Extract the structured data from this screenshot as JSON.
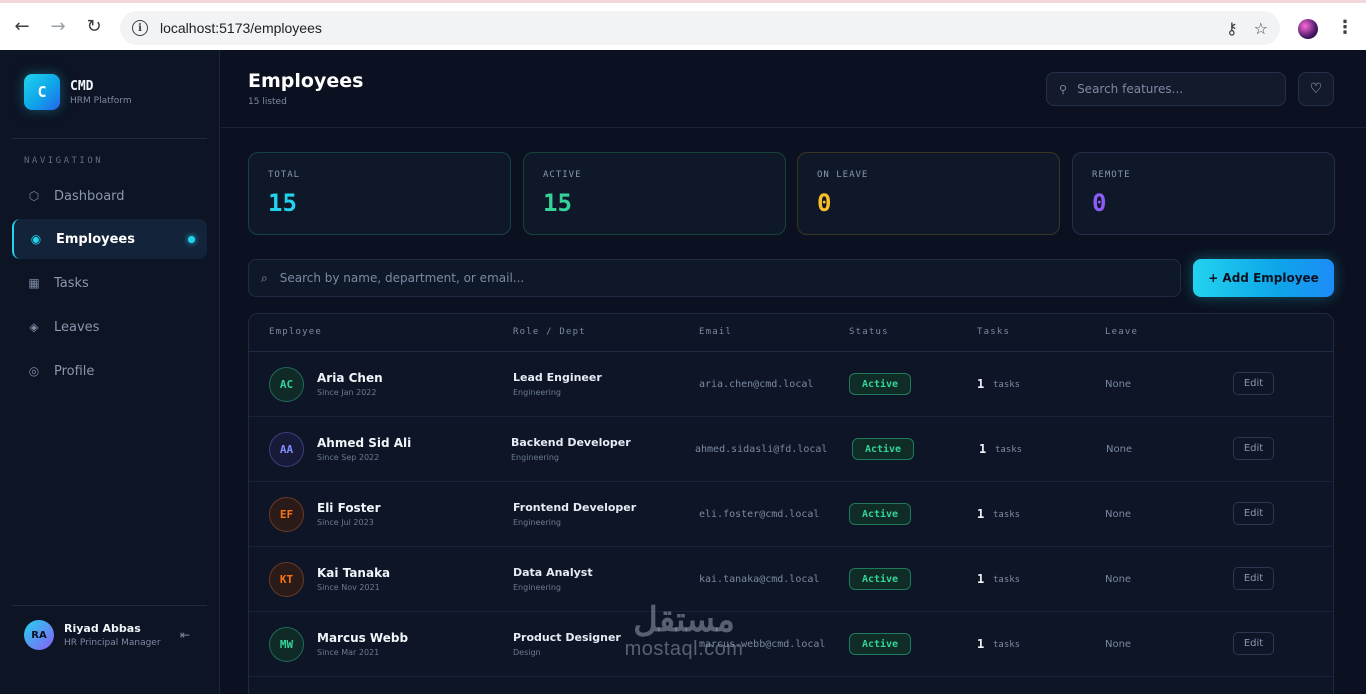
{
  "browser": {
    "url": "localhost:5173/employees",
    "icons": [
      "back-icon",
      "forward-icon",
      "reload-icon",
      "info-icon",
      "key-icon",
      "star-icon",
      "profile-avatar",
      "menu-dots-icon"
    ]
  },
  "sidebar": {
    "brand_initial": "C",
    "brand_name": "CMD",
    "brand_sub": "HRM Platform",
    "nav_label": "NAVIGATION",
    "items": [
      {
        "label": "Dashboard",
        "icon": "hexagon-icon"
      },
      {
        "label": "Employees",
        "icon": "radio-dot-icon",
        "active": true
      },
      {
        "label": "Tasks",
        "icon": "grid-icon"
      },
      {
        "label": "Leaves",
        "icon": "diamond-icon"
      },
      {
        "label": "Profile",
        "icon": "circle-icon"
      }
    ],
    "user": {
      "initials": "RA",
      "name": "Riyad Abbas",
      "role": "HR Principal Manager"
    }
  },
  "header": {
    "title": "Employees",
    "subtitle": "15 listed",
    "search_placeholder": "Search features..."
  },
  "stats": [
    {
      "label": "TOTAL",
      "value": "15",
      "color": "#22d3ee"
    },
    {
      "label": "ACTIVE",
      "value": "15",
      "color": "#34d399"
    },
    {
      "label": "ON LEAVE",
      "value": "0",
      "color": "#fbbf24"
    },
    {
      "label": "REMOTE",
      "value": "0",
      "color": "#8b5cf6"
    }
  ],
  "search": {
    "placeholder": "Search by name, department, or email..."
  },
  "add_button": "+ Add Employee",
  "table": {
    "columns": [
      "Employee",
      "Role / Dept",
      "Email",
      "Status",
      "Tasks",
      "Leave"
    ],
    "rows": [
      {
        "initials": "AC",
        "name": "Aria Chen",
        "since": "Since Jan 2022",
        "role": "Lead Engineer",
        "dept": "Engineering",
        "email": "aria.chen@cmd.local",
        "status": "Active",
        "tasks": "1",
        "tasks_label": "tasks",
        "leave": "None",
        "edit": "Edit",
        "color": "#34d399",
        "bg": "#0f2a27",
        "border": "#1f6b55"
      },
      {
        "initials": "AA",
        "name": "Ahmed Sid Ali",
        "since": "Since Sep 2022",
        "role": "Backend Developer",
        "dept": "Engineering",
        "email": "ahmed.sidasli@fd.local",
        "status": "Active",
        "tasks": "1",
        "tasks_label": "tasks",
        "leave": "None",
        "edit": "Edit",
        "color": "#818cf8",
        "bg": "#181a3a",
        "border": "#3b3f7a"
      },
      {
        "initials": "EF",
        "name": "Eli Foster",
        "since": "Since Jul 2023",
        "role": "Frontend Developer",
        "dept": "Engineering",
        "email": "eli.foster@cmd.local",
        "status": "Active",
        "tasks": "1",
        "tasks_label": "tasks",
        "leave": "None",
        "edit": "Edit",
        "color": "#f97316",
        "bg": "#2a1a18",
        "border": "#6b3a24"
      },
      {
        "initials": "KT",
        "name": "Kai Tanaka",
        "since": "Since Nov 2021",
        "role": "Data Analyst",
        "dept": "Engineering",
        "email": "kai.tanaka@cmd.local",
        "status": "Active",
        "tasks": "1",
        "tasks_label": "tasks",
        "leave": "None",
        "edit": "Edit",
        "color": "#f97316",
        "bg": "#2a1a18",
        "border": "#6b3a24"
      },
      {
        "initials": "MW",
        "name": "Marcus Webb",
        "since": "Since Mar 2021",
        "role": "Product Designer",
        "dept": "Design",
        "email": "marcus.webb@cmd.local",
        "status": "Active",
        "tasks": "1",
        "tasks_label": "tasks",
        "leave": "None",
        "edit": "Edit",
        "color": "#34d399",
        "bg": "#0f2a27",
        "border": "#1f6b55"
      }
    ]
  },
  "watermark": {
    "arabic": "مستقل",
    "latin": "mostaql.com"
  }
}
